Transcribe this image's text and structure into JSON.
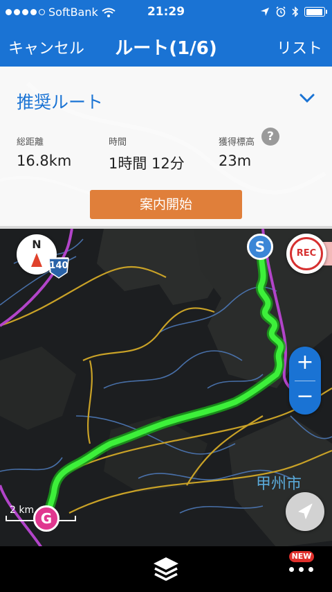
{
  "status_bar": {
    "carrier": "SoftBank",
    "time": "21:29",
    "signal_bars_filled": 4,
    "signal_bars_total": 5,
    "battery_level": 0.95
  },
  "nav": {
    "cancel_label": "キャンセル",
    "title": "ルート(1/6)",
    "list_label": "リスト"
  },
  "route_panel": {
    "route_name": "推奨ルート",
    "stats": [
      {
        "label": "総距離",
        "value": "16.8km"
      },
      {
        "label": "時間",
        "value": "1時間 12分"
      },
      {
        "label": "獲得標高",
        "value": "23m"
      }
    ],
    "help_label": "?",
    "start_button_label": "案内開始"
  },
  "map": {
    "compass_label": "N",
    "start_marker": "S",
    "goal_marker": "G",
    "rec_label": "REC",
    "zoom_in": "+",
    "zoom_out": "−",
    "road_number": "140",
    "place_label": "甲州市",
    "scale_label": "2 km",
    "route_color": "#3df03a"
  },
  "toolbar": {
    "layers_icon": "layers-icon",
    "more_icon": "more-dots-icon",
    "new_badge": "NEW"
  },
  "colors": {
    "accent": "#1a73d4",
    "start_button": "#e07f3a",
    "rec": "#d63030",
    "goal": "#e0378f"
  }
}
